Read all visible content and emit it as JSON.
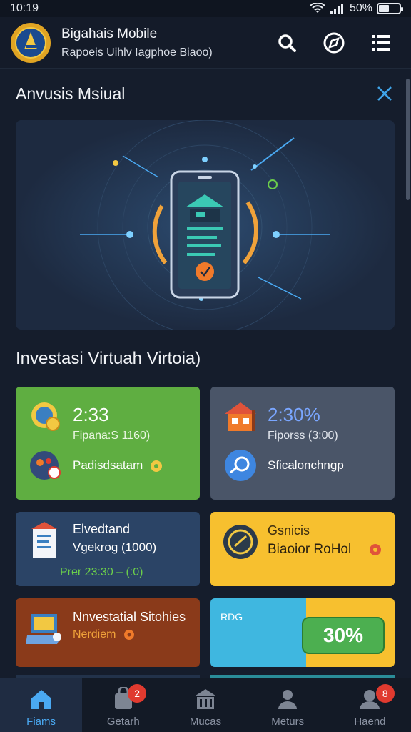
{
  "status_bar": {
    "time": "10:19",
    "battery": "50%",
    "battery_level": 0.5
  },
  "app_bar": {
    "title": "Bigahais Mobile",
    "subtitle": "Rapoeis Uihlv Iagphoe Biaoo)",
    "actions": [
      "search-icon",
      "compass-icon",
      "menu-icon"
    ]
  },
  "section": {
    "title": "Anvusis Msiual"
  },
  "hero": {
    "image": "phone-investment-illustration"
  },
  "investments": {
    "title": "Investasi Virtuah Virtoia)",
    "cards": [
      {
        "value": "2:33",
        "line": "Fipana:S 1160)",
        "label": "Padisdsatam",
        "color": "#5fae41"
      },
      {
        "value": "2:30%",
        "line": "Fiporss (3:00)",
        "label": "Sficalonchngp",
        "color": "#4a5568"
      },
      {
        "title": "Elvedtand",
        "line": "Vgekrog (1000)",
        "footer": "Prer 23:30 – (:0)",
        "color": "#2b4466"
      },
      {
        "title": "Gsnicis",
        "line": "Biaoior RoHol",
        "color": "#f7c02f"
      },
      {
        "title": "Nnvestatial Sitohies",
        "line": "Nerdiem",
        "color": "#8a3a1a"
      },
      {
        "label": "RDG",
        "badge": "30%",
        "colors": [
          "#3fb7e0",
          "#f7c02f",
          "#4caf50"
        ]
      }
    ]
  },
  "bottom_nav": {
    "items": [
      {
        "label": "Fiams",
        "icon": "home-icon",
        "active": true
      },
      {
        "label": "Getarh",
        "icon": "bag-icon",
        "badge": "2"
      },
      {
        "label": "Mucas",
        "icon": "building-icon"
      },
      {
        "label": "Meturs",
        "icon": "person-icon"
      },
      {
        "label": "Haend",
        "icon": "profile-icon",
        "badge": "8"
      }
    ]
  }
}
